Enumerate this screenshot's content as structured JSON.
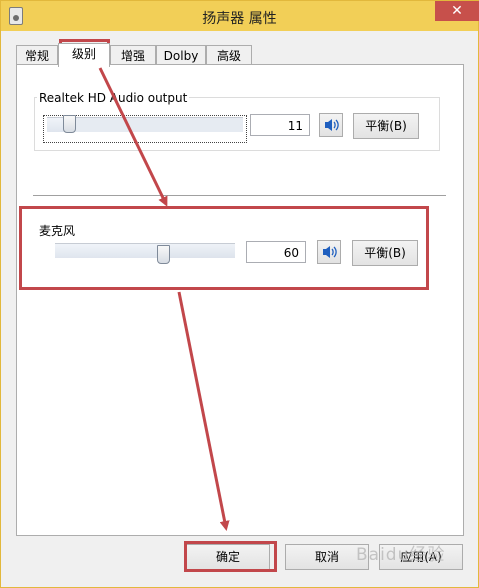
{
  "window": {
    "title": "扬声器 属性",
    "close": "✕"
  },
  "tabs": [
    {
      "label": "常规"
    },
    {
      "label": "级别"
    },
    {
      "label": "增强"
    },
    {
      "label": "Dolby"
    },
    {
      "label": "高级"
    }
  ],
  "output": {
    "title": "Realtek HD Audio output",
    "value": "11",
    "balance": "平衡(B)",
    "level": 0.11
  },
  "mic": {
    "title": "麦克风",
    "value": "60",
    "balance": "平衡(B)",
    "level": 0.6
  },
  "footer": {
    "ok": "确定",
    "cancel": "取消",
    "apply": "应用(A)"
  },
  "watermark": "Baidu经验",
  "colors": {
    "annotation": "#c2474b",
    "titlebar": "#f2cf57"
  }
}
